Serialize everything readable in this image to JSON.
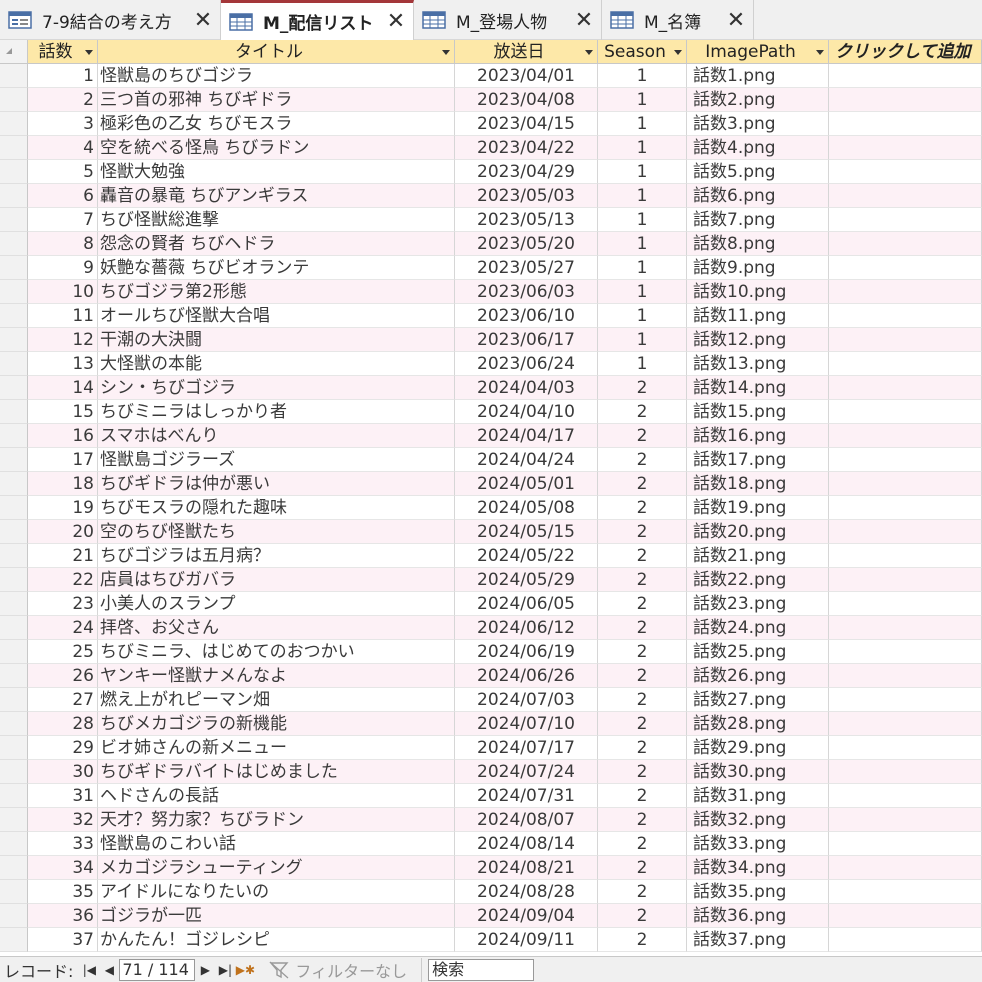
{
  "tabs": [
    {
      "label": "7-9結合の考え方",
      "icon": "form-icon",
      "active": false
    },
    {
      "label": "M_配信リスト",
      "icon": "table-icon",
      "active": true
    },
    {
      "label": "M_登場人物",
      "icon": "table-icon",
      "active": false
    },
    {
      "label": "M_名簿",
      "icon": "table-icon",
      "active": false
    }
  ],
  "close_glyph": "✕",
  "columns": {
    "num": "話数",
    "title": "タイトル",
    "date": "放送日",
    "season": "Season",
    "image": "ImagePath",
    "add": "クリックして追加"
  },
  "rows": [
    {
      "num": "1",
      "title": "怪獣島のちびゴジラ",
      "date": "2023/04/01",
      "season": "1",
      "image": "話数1.png"
    },
    {
      "num": "2",
      "title": "三つ首の邪神 ちびギドラ",
      "date": "2023/04/08",
      "season": "1",
      "image": "話数2.png"
    },
    {
      "num": "3",
      "title": "極彩色の乙女 ちびモスラ",
      "date": "2023/04/15",
      "season": "1",
      "image": "話数3.png"
    },
    {
      "num": "4",
      "title": "空を統べる怪鳥 ちびラドン",
      "date": "2023/04/22",
      "season": "1",
      "image": "話数4.png"
    },
    {
      "num": "5",
      "title": "怪獣大勉強",
      "date": "2023/04/29",
      "season": "1",
      "image": "話数5.png"
    },
    {
      "num": "6",
      "title": "轟音の暴竜 ちびアンギラス",
      "date": "2023/05/03",
      "season": "1",
      "image": "話数6.png"
    },
    {
      "num": "7",
      "title": "ちび怪獣総進撃",
      "date": "2023/05/13",
      "season": "1",
      "image": "話数7.png"
    },
    {
      "num": "8",
      "title": "怨念の賢者 ちびヘドラ",
      "date": "2023/05/20",
      "season": "1",
      "image": "話数8.png"
    },
    {
      "num": "9",
      "title": "妖艶な薔薇 ちびビオランテ",
      "date": "2023/05/27",
      "season": "1",
      "image": "話数9.png"
    },
    {
      "num": "10",
      "title": "ちびゴジラ第2形態",
      "date": "2023/06/03",
      "season": "1",
      "image": "話数10.png"
    },
    {
      "num": "11",
      "title": "オールちび怪獣大合唱",
      "date": "2023/06/10",
      "season": "1",
      "image": "話数11.png"
    },
    {
      "num": "12",
      "title": "干潮の大決闘",
      "date": "2023/06/17",
      "season": "1",
      "image": "話数12.png"
    },
    {
      "num": "13",
      "title": "大怪獣の本能",
      "date": "2023/06/24",
      "season": "1",
      "image": "話数13.png"
    },
    {
      "num": "14",
      "title": "シン・ちびゴジラ",
      "date": "2024/04/03",
      "season": "2",
      "image": "話数14.png"
    },
    {
      "num": "15",
      "title": "ちびミニラはしっかり者",
      "date": "2024/04/10",
      "season": "2",
      "image": "話数15.png"
    },
    {
      "num": "16",
      "title": "スマホはべんり",
      "date": "2024/04/17",
      "season": "2",
      "image": "話数16.png"
    },
    {
      "num": "17",
      "title": "怪獣島ゴジラーズ",
      "date": "2024/04/24",
      "season": "2",
      "image": "話数17.png"
    },
    {
      "num": "18",
      "title": "ちびギドラは仲が悪い",
      "date": "2024/05/01",
      "season": "2",
      "image": "話数18.png"
    },
    {
      "num": "19",
      "title": "ちびモスラの隠れた趣味",
      "date": "2024/05/08",
      "season": "2",
      "image": "話数19.png"
    },
    {
      "num": "20",
      "title": "空のちび怪獣たち",
      "date": "2024/05/15",
      "season": "2",
      "image": "話数20.png"
    },
    {
      "num": "21",
      "title": "ちびゴジラは五月病？",
      "date": "2024/05/22",
      "season": "2",
      "image": "話数21.png"
    },
    {
      "num": "22",
      "title": "店員はちびガバラ",
      "date": "2024/05/29",
      "season": "2",
      "image": "話数22.png"
    },
    {
      "num": "23",
      "title": "小美人のスランプ",
      "date": "2024/06/05",
      "season": "2",
      "image": "話数23.png"
    },
    {
      "num": "24",
      "title": "拝啓、お父さん",
      "date": "2024/06/12",
      "season": "2",
      "image": "話数24.png"
    },
    {
      "num": "25",
      "title": "ちびミニラ、はじめてのおつかい",
      "date": "2024/06/19",
      "season": "2",
      "image": "話数25.png"
    },
    {
      "num": "26",
      "title": "ヤンキー怪獣ナメんなよ",
      "date": "2024/06/26",
      "season": "2",
      "image": "話数26.png"
    },
    {
      "num": "27",
      "title": "燃え上がれピーマン畑",
      "date": "2024/07/03",
      "season": "2",
      "image": "話数27.png"
    },
    {
      "num": "28",
      "title": "ちびメカゴジラの新機能",
      "date": "2024/07/10",
      "season": "2",
      "image": "話数28.png"
    },
    {
      "num": "29",
      "title": "ビオ姉さんの新メニュー",
      "date": "2024/07/17",
      "season": "2",
      "image": "話数29.png"
    },
    {
      "num": "30",
      "title": "ちびギドラバイトはじめました",
      "date": "2024/07/24",
      "season": "2",
      "image": "話数30.png"
    },
    {
      "num": "31",
      "title": "ヘドさんの長話",
      "date": "2024/07/31",
      "season": "2",
      "image": "話数31.png"
    },
    {
      "num": "32",
      "title": "天才？努力家？ちびラドン",
      "date": "2024/08/07",
      "season": "2",
      "image": "話数32.png"
    },
    {
      "num": "33",
      "title": "怪獣島のこわい話",
      "date": "2024/08/14",
      "season": "2",
      "image": "話数33.png"
    },
    {
      "num": "34",
      "title": "メカゴジラシューティング",
      "date": "2024/08/21",
      "season": "2",
      "image": "話数34.png"
    },
    {
      "num": "35",
      "title": "アイドルになりたいの",
      "date": "2024/08/28",
      "season": "2",
      "image": "話数35.png"
    },
    {
      "num": "36",
      "title": "ゴジラが一匹",
      "date": "2024/09/04",
      "season": "2",
      "image": "話数36.png"
    },
    {
      "num": "37",
      "title": "かんたん！ゴジレシピ",
      "date": "2024/09/11",
      "season": "2",
      "image": "話数37.png"
    }
  ],
  "status": {
    "record_label": "レコード:",
    "record_position": "71 / 114",
    "filter_label": "フィルターなし",
    "search_label": "検索"
  },
  "colors": {
    "header_bg": "#fde8a8",
    "active_tab_border": "#a4373a",
    "alt_row_bg": "#fdf1f6"
  }
}
